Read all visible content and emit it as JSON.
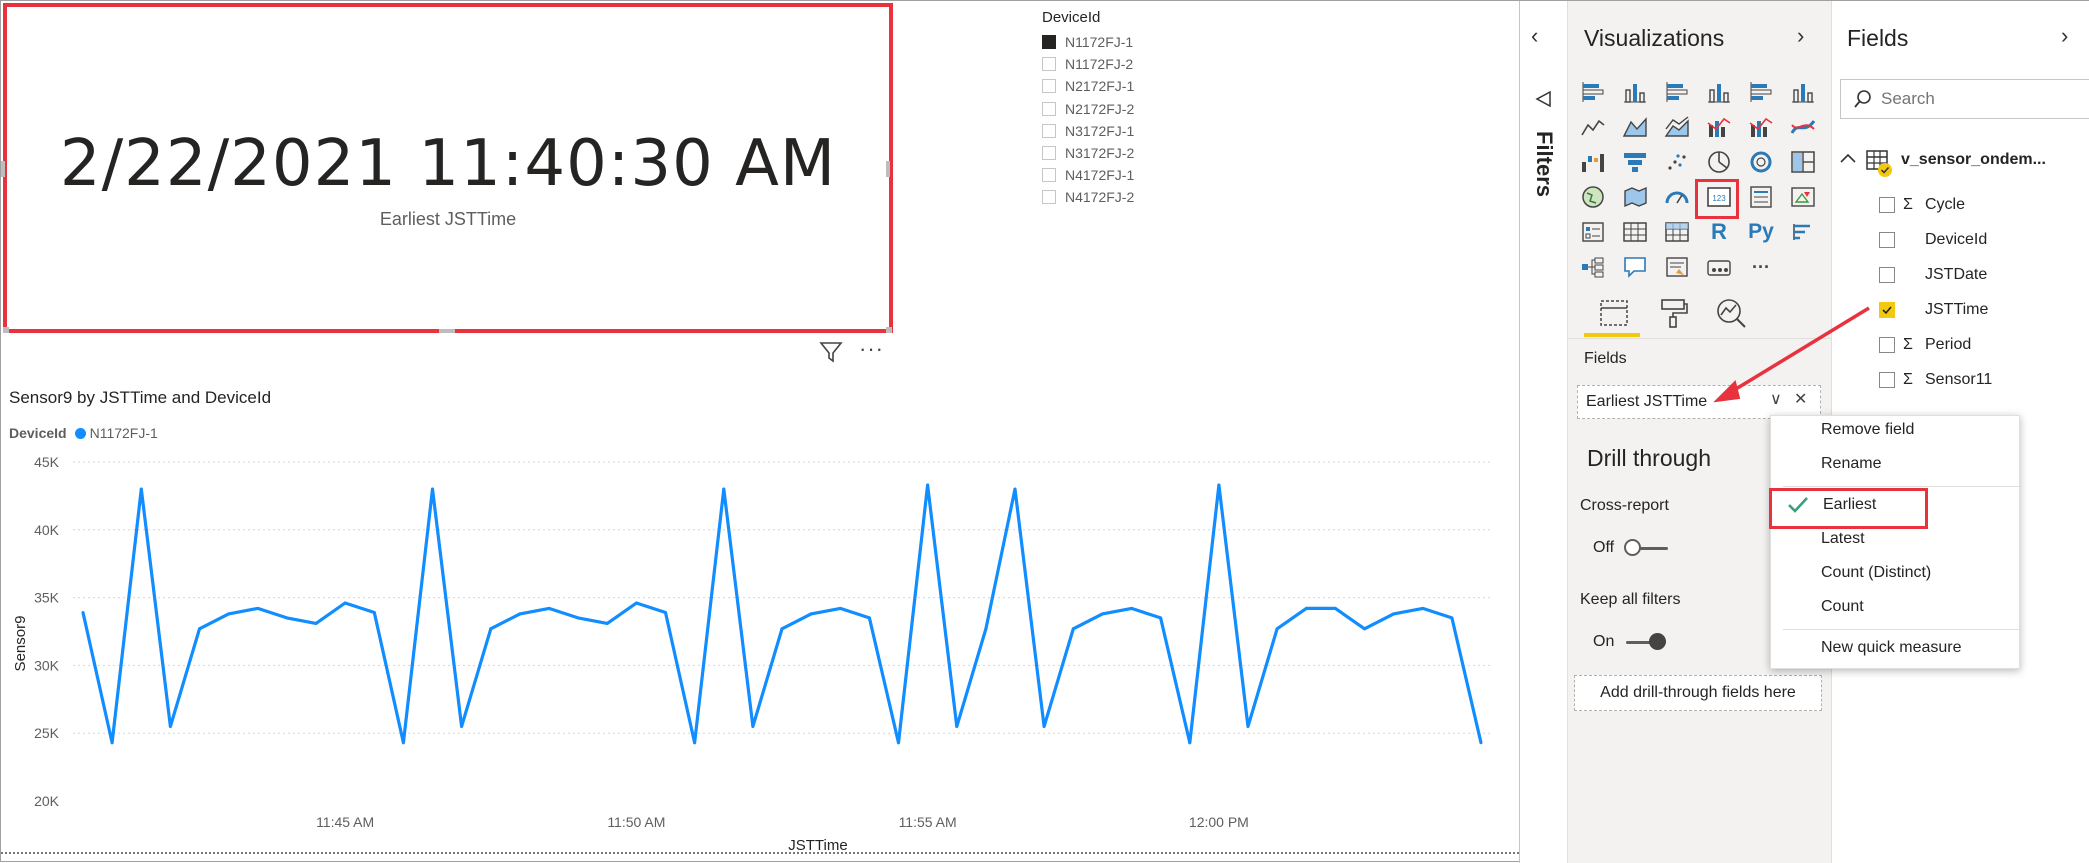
{
  "card": {
    "value": "2/22/2021 11:40:30 AM",
    "label": "Earliest JSTTime"
  },
  "slicer": {
    "title": "DeviceId",
    "items": [
      {
        "label": "N1172FJ-1",
        "checked": true
      },
      {
        "label": "N1172FJ-2",
        "checked": false
      },
      {
        "label": "N2172FJ-1",
        "checked": false
      },
      {
        "label": "N2172FJ-2",
        "checked": false
      },
      {
        "label": "N3172FJ-1",
        "checked": false
      },
      {
        "label": "N3172FJ-2",
        "checked": false
      },
      {
        "label": "N4172FJ-1",
        "checked": false
      },
      {
        "label": "N4172FJ-2",
        "checked": false
      }
    ]
  },
  "visual_header": {
    "filter_icon": "filter-icon",
    "more_icon": "more-options-icon",
    "more_glyph": "···"
  },
  "chart_data": {
    "type": "line",
    "title": "Sensor9 by JSTTime and DeviceId",
    "legend_title": "DeviceId",
    "xlabel": "JSTTime",
    "ylabel": "Sensor9",
    "ylim": [
      20000,
      45000
    ],
    "y_ticks": [
      "20K",
      "25K",
      "30K",
      "35K",
      "40K",
      "45K"
    ],
    "x_ticks": [
      "11:45 AM",
      "11:50 AM",
      "11:55 AM",
      "12:00 PM"
    ],
    "x_range": [
      "11:40:30 AM",
      "12:04:30 PM"
    ],
    "grid": true,
    "legend_position": "top-left",
    "series": [
      {
        "name": "N1172FJ-1",
        "color": "#118dff",
        "points": [
          [
            "11:40:30",
            33900
          ],
          [
            "11:41:00",
            24300
          ],
          [
            "11:41:30",
            43000
          ],
          [
            "11:42:00",
            25500
          ],
          [
            "11:42:30",
            32700
          ],
          [
            "11:43:00",
            33800
          ],
          [
            "11:43:30",
            34200
          ],
          [
            "11:44:00",
            33500
          ],
          [
            "11:44:30",
            33100
          ],
          [
            "11:45:00",
            34600
          ],
          [
            "11:45:30",
            33900
          ],
          [
            "11:46:00",
            24300
          ],
          [
            "11:46:30",
            43000
          ],
          [
            "11:47:00",
            25500
          ],
          [
            "11:47:30",
            32700
          ],
          [
            "11:48:00",
            33800
          ],
          [
            "11:48:30",
            34200
          ],
          [
            "11:49:00",
            33500
          ],
          [
            "11:49:30",
            33100
          ],
          [
            "11:50:00",
            34600
          ],
          [
            "11:50:30",
            33900
          ],
          [
            "11:51:00",
            24300
          ],
          [
            "11:51:30",
            43000
          ],
          [
            "11:52:00",
            25500
          ],
          [
            "11:52:30",
            32700
          ],
          [
            "11:53:00",
            33800
          ],
          [
            "11:53:30",
            34200
          ],
          [
            "11:54:00",
            33500
          ],
          [
            "11:54:30",
            24300
          ],
          [
            "11:55:00",
            43300
          ],
          [
            "11:55:30",
            25500
          ],
          [
            "11:56:00",
            32700
          ],
          [
            "11:56:30",
            43000
          ],
          [
            "11:57:00",
            25500
          ],
          [
            "11:57:30",
            32700
          ],
          [
            "11:58:00",
            33800
          ],
          [
            "11:58:30",
            34200
          ],
          [
            "11:59:00",
            33500
          ],
          [
            "11:59:30",
            24300
          ],
          [
            "12:00:00",
            43300
          ],
          [
            "12:00:30",
            25500
          ],
          [
            "12:01:00",
            32700
          ],
          [
            "12:01:30",
            34200
          ],
          [
            "12:02:00",
            34200
          ],
          [
            "12:02:30",
            32700
          ],
          [
            "12:03:00",
            33800
          ],
          [
            "12:03:30",
            34200
          ],
          [
            "12:04:00",
            33500
          ],
          [
            "12:04:30",
            24300
          ]
        ]
      }
    ]
  },
  "filters_pane": {
    "label": "Filters",
    "collapse_glyph": "‹"
  },
  "visualizations_pane": {
    "title": "Visualizations",
    "expand_glyph": "›",
    "icons": [
      "stacked-bar-icon",
      "stacked-column-icon",
      "clustered-bar-icon",
      "clustered-column-icon",
      "100-stacked-bar-icon",
      "100-stacked-column-icon",
      "line-chart-icon",
      "area-chart-icon",
      "stacked-area-icon",
      "line-clustered-column-icon",
      "line-stacked-column-icon",
      "ribbon-chart-icon",
      "waterfall-icon",
      "funnel-icon",
      "scatter-icon",
      "pie-chart-icon",
      "donut-chart-icon",
      "treemap-icon",
      "map-icon",
      "filled-map-icon",
      "gauge-icon",
      "card-icon",
      "multi-row-card-icon",
      "kpi-icon",
      "slicer-icon",
      "table-icon",
      "matrix-icon",
      "r-visual-icon",
      "python-visual-icon",
      "key-influencers-icon",
      "decomposition-tree-icon",
      "qa-icon",
      "smart-narrative-icon",
      "paginated-report-icon",
      "more-visuals-icon"
    ],
    "r_glyph": "R",
    "py_glyph": "Py",
    "more_glyph": "···",
    "tabs": [
      "fields-tab",
      "format-tab",
      "analytics-tab"
    ],
    "fields_label": "Fields",
    "field_well_value": "Earliest JSTTime",
    "field_well_chevron": "∨",
    "field_well_remove": "✕",
    "drill_through": {
      "title": "Drill through",
      "cross_report_label": "Cross-report",
      "cross_report_state": "Off",
      "keep_filters_label": "Keep all filters",
      "keep_filters_state": "On",
      "add_fields_button": "Add drill-through fields here"
    }
  },
  "fields_pane": {
    "title": "Fields",
    "expand_glyph": "›",
    "search_placeholder": "Search",
    "table_name": "v_sensor_ondem...",
    "fields": [
      {
        "name": "Cycle",
        "sigma": true,
        "checked": false
      },
      {
        "name": "DeviceId",
        "sigma": false,
        "checked": false
      },
      {
        "name": "JSTDate",
        "sigma": false,
        "checked": false
      },
      {
        "name": "JSTTime",
        "sigma": false,
        "checked": true
      },
      {
        "name": "Period",
        "sigma": true,
        "checked": false
      },
      {
        "name": "Sensor11",
        "sigma": true,
        "checked": false
      }
    ],
    "sigma_glyph": "Σ"
  },
  "context_menu": {
    "items": [
      "Remove field",
      "Rename",
      "Earliest",
      "Latest",
      "Count (Distinct)",
      "Count",
      "New quick measure"
    ],
    "selected": "Earliest"
  },
  "colors": {
    "accent": "#f2c811",
    "highlight_box": "#e8333f",
    "series": "#118dff"
  }
}
